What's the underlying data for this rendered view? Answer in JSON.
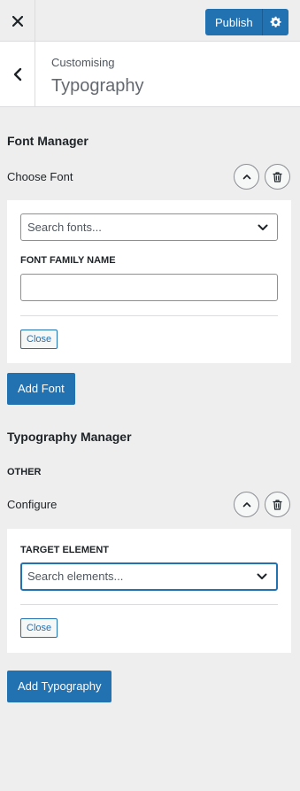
{
  "topbar": {
    "close_icon": "close-icon",
    "publish_label": "Publish",
    "settings_icon": "gear-icon",
    "accent": "#2271b1"
  },
  "header": {
    "back_icon": "chevron-left-icon",
    "breadcrumb": "Customising",
    "title": "Typography"
  },
  "font_manager": {
    "title": "Font Manager",
    "item_label": "Choose Font",
    "collapse_icon": "chevron-up-icon",
    "delete_icon": "trash-icon",
    "search_placeholder": "Search fonts...",
    "family_label": "FONT FAMILY NAME",
    "family_value": "",
    "close_label": "Close",
    "add_label": "Add Font"
  },
  "typography_manager": {
    "title": "Typography Manager",
    "group_label": "OTHER",
    "item_label": "Configure",
    "collapse_icon": "chevron-up-icon",
    "delete_icon": "trash-icon",
    "target_label": "TARGET ELEMENT",
    "search_placeholder": "Search elements...",
    "close_label": "Close",
    "add_label": "Add Typography"
  }
}
